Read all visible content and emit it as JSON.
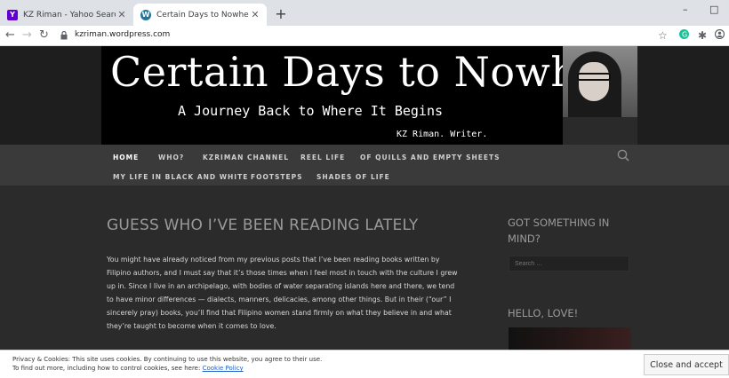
{
  "browser": {
    "tabs": [
      {
        "title": "KZ Riman - Yahoo Search Results",
        "active": false,
        "favicon": "yahoo-icon",
        "color": "#6001d2"
      },
      {
        "title": "Certain Days to Nowhere | A Jou",
        "active": true,
        "favicon": "wordpress-icon",
        "color": "#21759b"
      }
    ],
    "new_tab": "+",
    "address": "kzriman.wordpress.com",
    "window_controls": [
      "–",
      "□"
    ]
  },
  "site": {
    "banner": {
      "title": "Certain Days to Nowhere",
      "subtitle": "A Journey Back to Where It Begins",
      "author": "KZ Riman. Writer."
    },
    "menu": [
      {
        "label": "HOME",
        "active": true
      },
      {
        "label": "WHO?",
        "active": false
      },
      {
        "label": "KZRIMAN CHANNEL",
        "active": false
      },
      {
        "label": "REEL LIFE",
        "active": false
      },
      {
        "label": "OF QUILLS AND EMPTY SHEETS",
        "active": false
      },
      {
        "label": "MY LIFE IN BLACK AND WHITE",
        "active": false
      },
      {
        "label": "FOOTSTEPS",
        "active": false
      },
      {
        "label": "SHADES OF LIFE",
        "active": false
      }
    ],
    "post": {
      "title": "GUESS WHO I’VE BEEN READING LATELY",
      "body": "You might have already noticed from my previous posts that I’ve been reading books written by Filipino authors, and I must say that it’s those times when I feel most in touch with the culture I grew up in. Since I live in an archipelago, with bodies of water separating islands here and there, we tend to have minor differences — dialects, manners, delicacies, among other things. But in their (“our” I sincerely pray) books, you’ll find that Filipino women stand firmly on what they believe in and what they’re taught to become when it comes to love."
    },
    "sidebar": {
      "widget1_title": "GOT SOMETHING IN MIND?",
      "search_placeholder": "Search …",
      "widget2_title": "HELLO, LOVE!"
    },
    "cookie": {
      "line1": "Privacy & Cookies: This site uses cookies. By continuing to use this website, you agree to their use.",
      "line2": "To find out more, including how to control cookies, see here: ",
      "link": "Cookie Policy",
      "button": "Close and accept"
    }
  }
}
